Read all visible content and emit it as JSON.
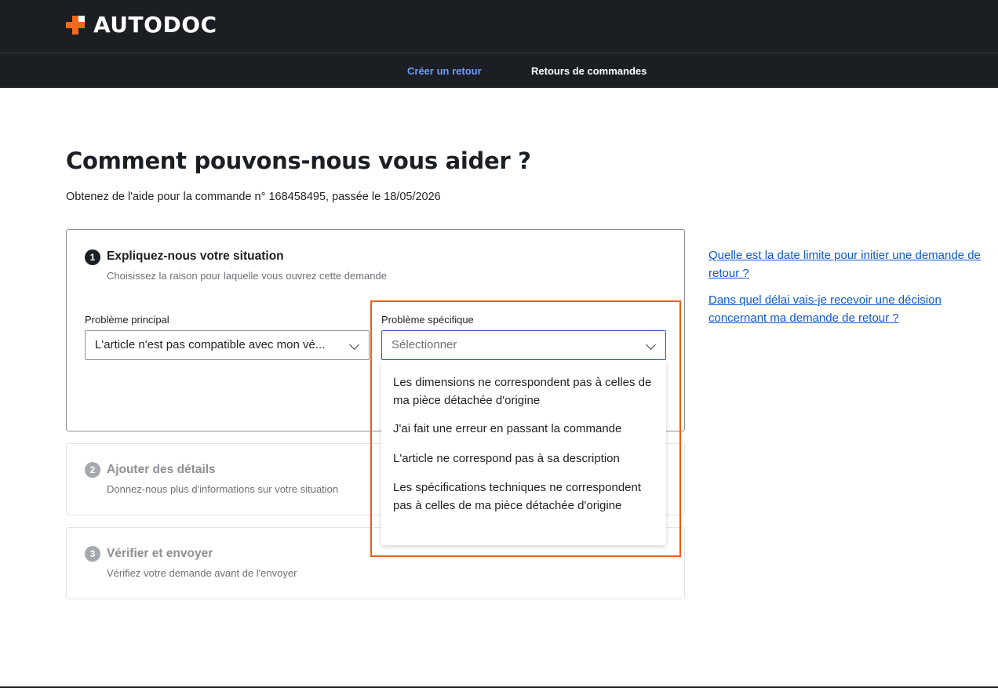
{
  "header": {
    "brand_name": "AUTODOC",
    "brand_color": "#f06a1d",
    "logo_icon": "plus-cross-icon",
    "tabs": [
      {
        "label": "Créer un retour",
        "active": true
      },
      {
        "label": "Retours de commandes",
        "active": false
      }
    ]
  },
  "main": {
    "title": "Comment pouvons-nous vous aider ?",
    "subtitle": "Obtenez de l'aide pour la commande n° 168458495, passée le 18/05/2026"
  },
  "steps": [
    {
      "number": "1",
      "title": "Expliquez-nous votre situation",
      "description": "Choisissez la raison pour laquelle vous ouvrez cette demande",
      "fields": {
        "main_problem": {
          "label": "Problème principal",
          "value": "L'article n'est pas compatible avec mon vé..."
        },
        "specific_problem": {
          "label": "Problème spécifique",
          "placeholder": "Sélectionner",
          "options": [
            "Les dimensions ne correspondent pas à celles de ma pièce détachée d'origine",
            "J'ai fait une erreur en passant la commande",
            "L'article ne correspond pas à sa description",
            "Les spécifications techniques ne correspondent pas à celles de ma pièce détachée d'origine"
          ]
        }
      }
    },
    {
      "number": "2",
      "title": "Ajouter des détails",
      "description": "Donnez-nous plus d'informations sur votre situation"
    },
    {
      "number": "3",
      "title": "Vérifier et envoyer",
      "description": "Vérifiez votre demande avant de l'envoyer"
    }
  ],
  "faq_links": [
    "Quelle est la date limite pour initier une demande de retour ?",
    "Dans quel délai vais-je recevoir une décision concernant ma demande de retour ?"
  ],
  "colors": {
    "header_bg": "#1b1f24",
    "active_tab": "#6b9dff",
    "link": "#0b58d1",
    "highlight": "#ee5d12"
  }
}
